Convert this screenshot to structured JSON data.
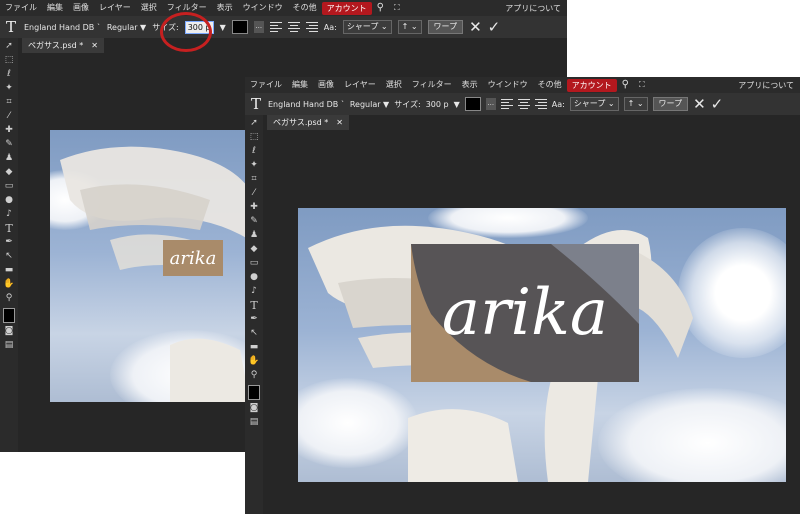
{
  "menu": {
    "items": [
      "ファイル",
      "編集",
      "画像",
      "レイヤー",
      "選択",
      "フィルター",
      "表示",
      "ウインドウ",
      "その他",
      "アカウント"
    ],
    "about_back": "アプリについて",
    "about_front": "アプリについて"
  },
  "options": {
    "font": "England Hand DB `",
    "style": "Regular ▼",
    "size_label": "サイズ:",
    "size_back": "300 p",
    "size_front": "300 p",
    "dots": "...",
    "aa_label": "Aa:",
    "antialias": "シャープ",
    "direction": "↑",
    "warp": "ワープ"
  },
  "document": {
    "tab": "ペガサス.psd *",
    "close": "✕"
  },
  "canvas": {
    "text": "arika"
  },
  "colors": {
    "accent": "#b3181e",
    "highlight_circle": "#c62020",
    "text_fill": "#a98b6a"
  }
}
